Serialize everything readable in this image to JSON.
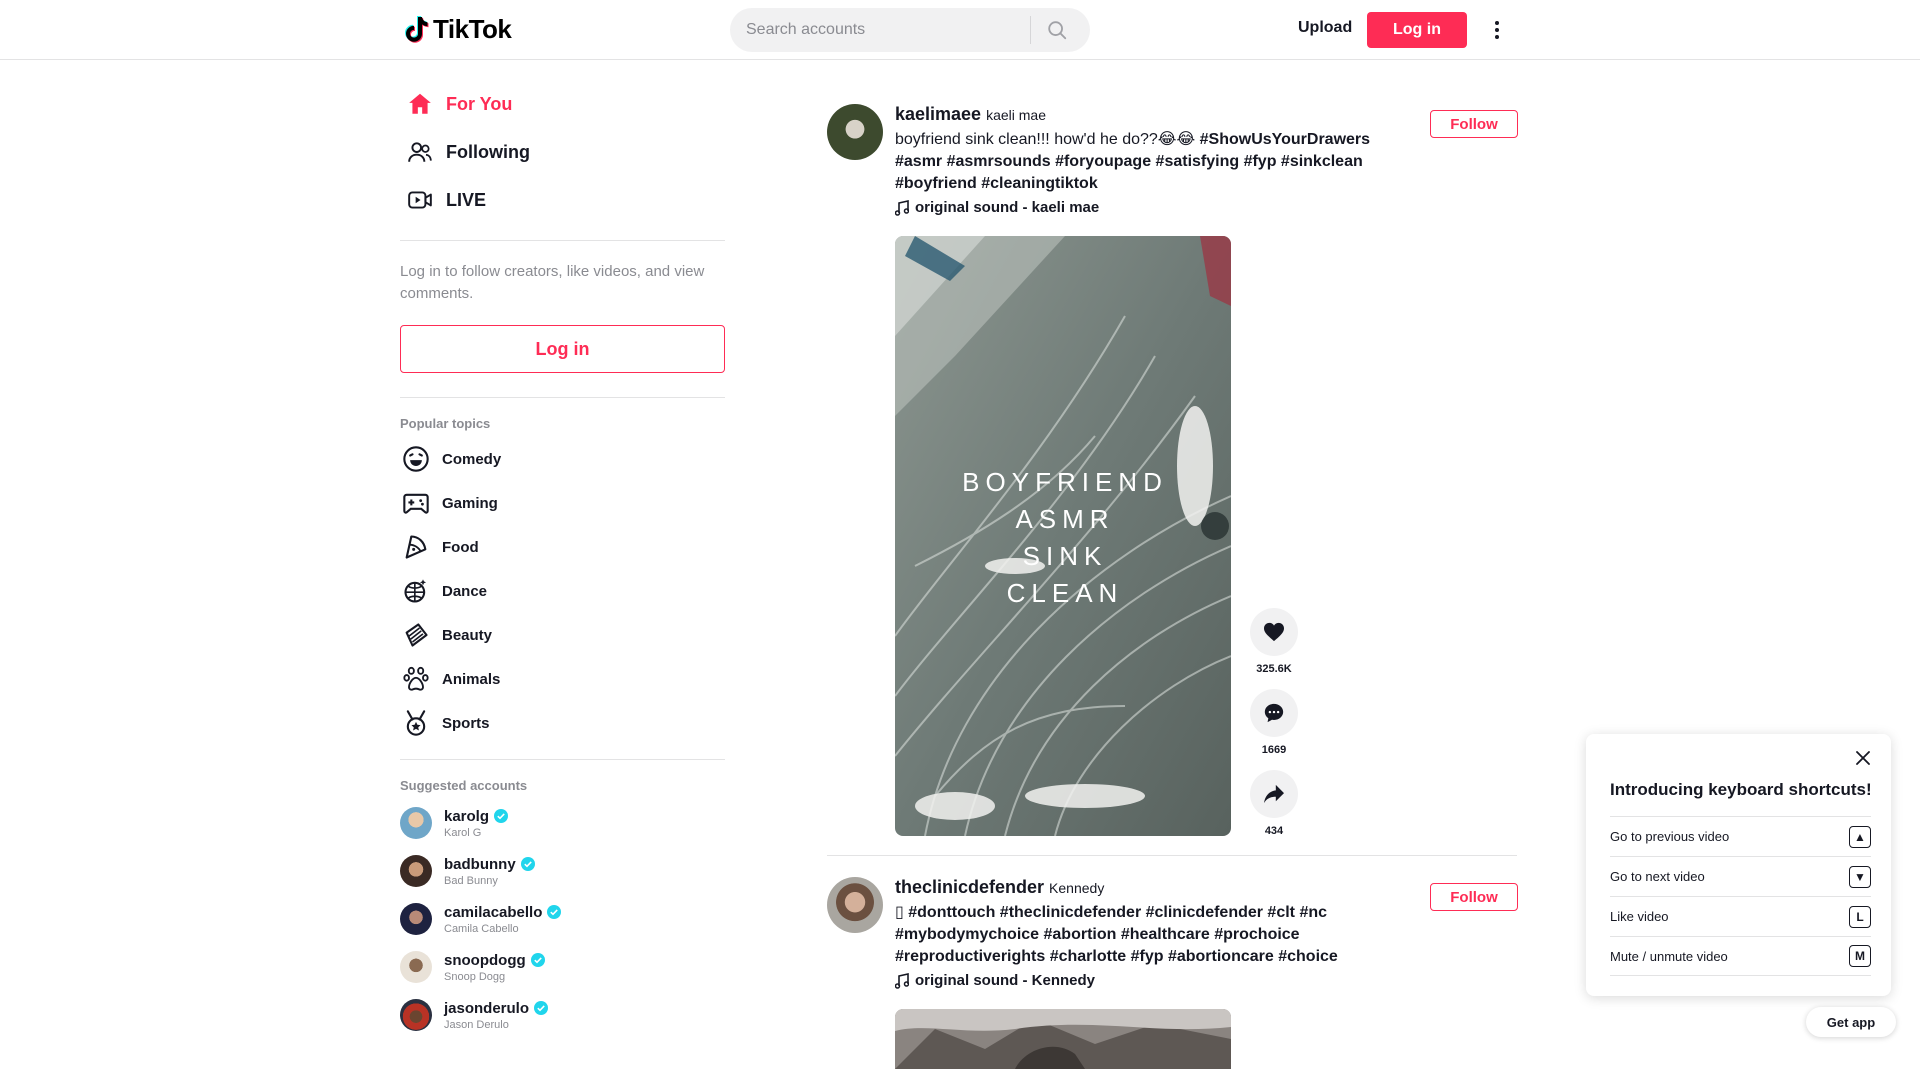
{
  "header": {
    "logo_text": "TikTok",
    "search_placeholder": "Search accounts",
    "upload_label": "Upload",
    "login_label": "Log in"
  },
  "sidebar": {
    "nav": [
      {
        "label": "For You",
        "icon": "home-icon",
        "active": true
      },
      {
        "label": "Following",
        "icon": "users-icon",
        "active": false
      },
      {
        "label": "LIVE",
        "icon": "live-icon",
        "active": false
      }
    ],
    "login_prompt": "Log in to follow creators, like videos, and view comments.",
    "login_button": "Log in",
    "popular_topics_title": "Popular topics",
    "topics": [
      {
        "label": "Comedy",
        "icon": "comedy-icon"
      },
      {
        "label": "Gaming",
        "icon": "gaming-icon"
      },
      {
        "label": "Food",
        "icon": "food-icon"
      },
      {
        "label": "Dance",
        "icon": "dance-icon"
      },
      {
        "label": "Beauty",
        "icon": "beauty-icon"
      },
      {
        "label": "Animals",
        "icon": "animals-icon"
      },
      {
        "label": "Sports",
        "icon": "sports-icon"
      }
    ],
    "suggested_title": "Suggested accounts",
    "accounts": [
      {
        "username": "karolg",
        "name": "Karol G",
        "verified": true
      },
      {
        "username": "badbunny",
        "name": "Bad Bunny",
        "verified": true
      },
      {
        "username": "camilacabello",
        "name": "Camila Cabello",
        "verified": true
      },
      {
        "username": "snoopdogg",
        "name": "Snoop Dogg",
        "verified": true
      },
      {
        "username": "jasonderulo",
        "name": "Jason Derulo",
        "verified": true
      }
    ]
  },
  "feed": {
    "posts": [
      {
        "author_id": "kaelimaee",
        "author_nick": "kaeli mae",
        "caption_text": "boyfriend sink clean!!! how'd he do??😂😂 ",
        "hashtags": "#ShowUsYourDrawers #asmr #asmrsounds #foryoupage #satisfying #fyp #sinkclean #boyfriend #cleaningtiktok",
        "music": "original sound - kaeli mae",
        "follow_label": "Follow",
        "video_overlay": [
          "BOYFRIEND",
          "ASMR",
          "SINK",
          "CLEAN"
        ],
        "likes": "325.6K",
        "comments": "1669",
        "shares": "434"
      },
      {
        "author_id": "theclinicdefender",
        "author_nick": "Kennedy",
        "caption_text": "▯ ",
        "hashtags": "#donttouch #theclinicdefender #clinicdefender #clt #nc #mybodymychoice #abortion #healthcare #prochoice #reproductiverights #charlotte #fyp #abortioncare #choice",
        "music": "original sound - Kennedy",
        "follow_label": "Follow"
      }
    ]
  },
  "shortcuts": {
    "title": "Introducing keyboard shortcuts!",
    "items": [
      {
        "label": "Go to previous video",
        "key": "▲"
      },
      {
        "label": "Go to next video",
        "key": "▼"
      },
      {
        "label": "Like video",
        "key": "L"
      },
      {
        "label": "Mute / unmute video",
        "key": "M"
      }
    ]
  },
  "get_app_label": "Get app",
  "colors": {
    "brand": "#fe2c55",
    "text": "#161823",
    "muted": "#8a8b91",
    "verified": "#20d5ec"
  }
}
